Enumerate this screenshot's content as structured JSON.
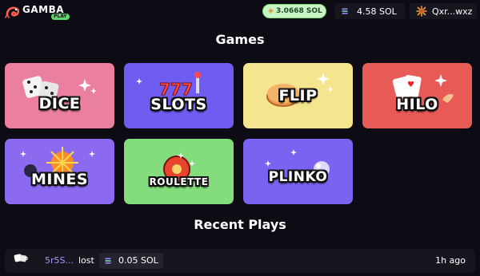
{
  "header": {
    "logo_text": "GAMBA",
    "logo_badge": "PLAY",
    "pool_amount": "3.0668 SOL",
    "balance": "4.58 SOL",
    "user": "Qxr...wxz"
  },
  "sections": {
    "games_title": "Games",
    "recent_title": "Recent Plays"
  },
  "games": [
    {
      "label": "DICE",
      "color": "#ea7f9f"
    },
    {
      "label": "SLOTS",
      "color": "#6f5cf0"
    },
    {
      "label": "FLIP",
      "color": "#f5e58e"
    },
    {
      "label": "HILO",
      "color": "#e85a56"
    },
    {
      "label": "MINES",
      "color": "#8c6af0"
    },
    {
      "label": "ROULETTE",
      "color": "#84dd7d"
    },
    {
      "label": "PLINKO",
      "color": "#7c62f0"
    }
  ],
  "recent_plays": [
    {
      "game": "Dice",
      "player": "5r5S...",
      "result": "lost",
      "amount": "0.05 SOL",
      "time": "1h ago"
    }
  ],
  "colors": {
    "background": "#0d0c14",
    "panel": "#17161f",
    "accent": "#a496ff",
    "pool_bg": "#c8f5c5"
  }
}
